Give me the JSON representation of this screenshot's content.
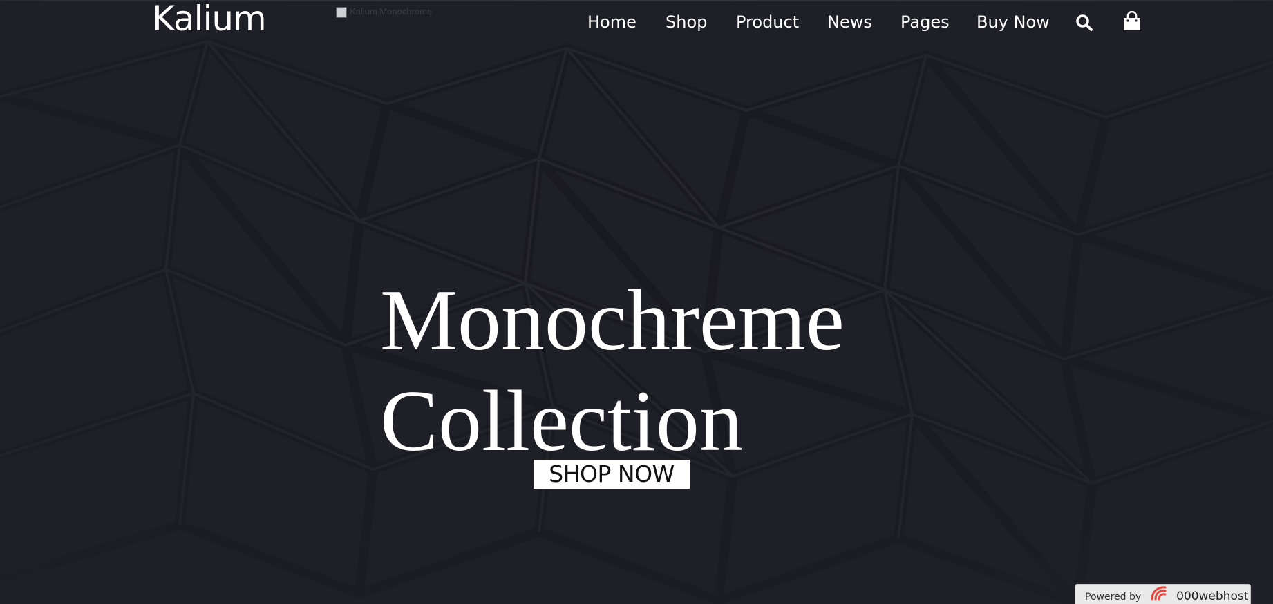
{
  "header": {
    "logo_text": "Kalium",
    "broken_image_alt": "Kalium Monochrome",
    "nav": {
      "items": [
        {
          "label": "Home"
        },
        {
          "label": "Shop"
        },
        {
          "label": "Product"
        },
        {
          "label": "News"
        },
        {
          "label": "Pages"
        },
        {
          "label": "Buy Now"
        }
      ],
      "search_icon": "search-icon",
      "cart_icon": "shopping-bag-icon"
    }
  },
  "hero": {
    "title_line1": "Monochreme",
    "title_line2": "Collection",
    "cta_label": "SHOP NOW"
  },
  "footer_badge": {
    "prefix": "Powered by",
    "brand": "000webhost",
    "brand_icon": "000webhost-logo-icon"
  },
  "colors": {
    "background": "#1f2027",
    "text": "#ffffff",
    "button_bg": "#ffffff",
    "button_text": "#111111",
    "badge_bg": "#e9e9ea",
    "brand_red": "#e8473b"
  }
}
